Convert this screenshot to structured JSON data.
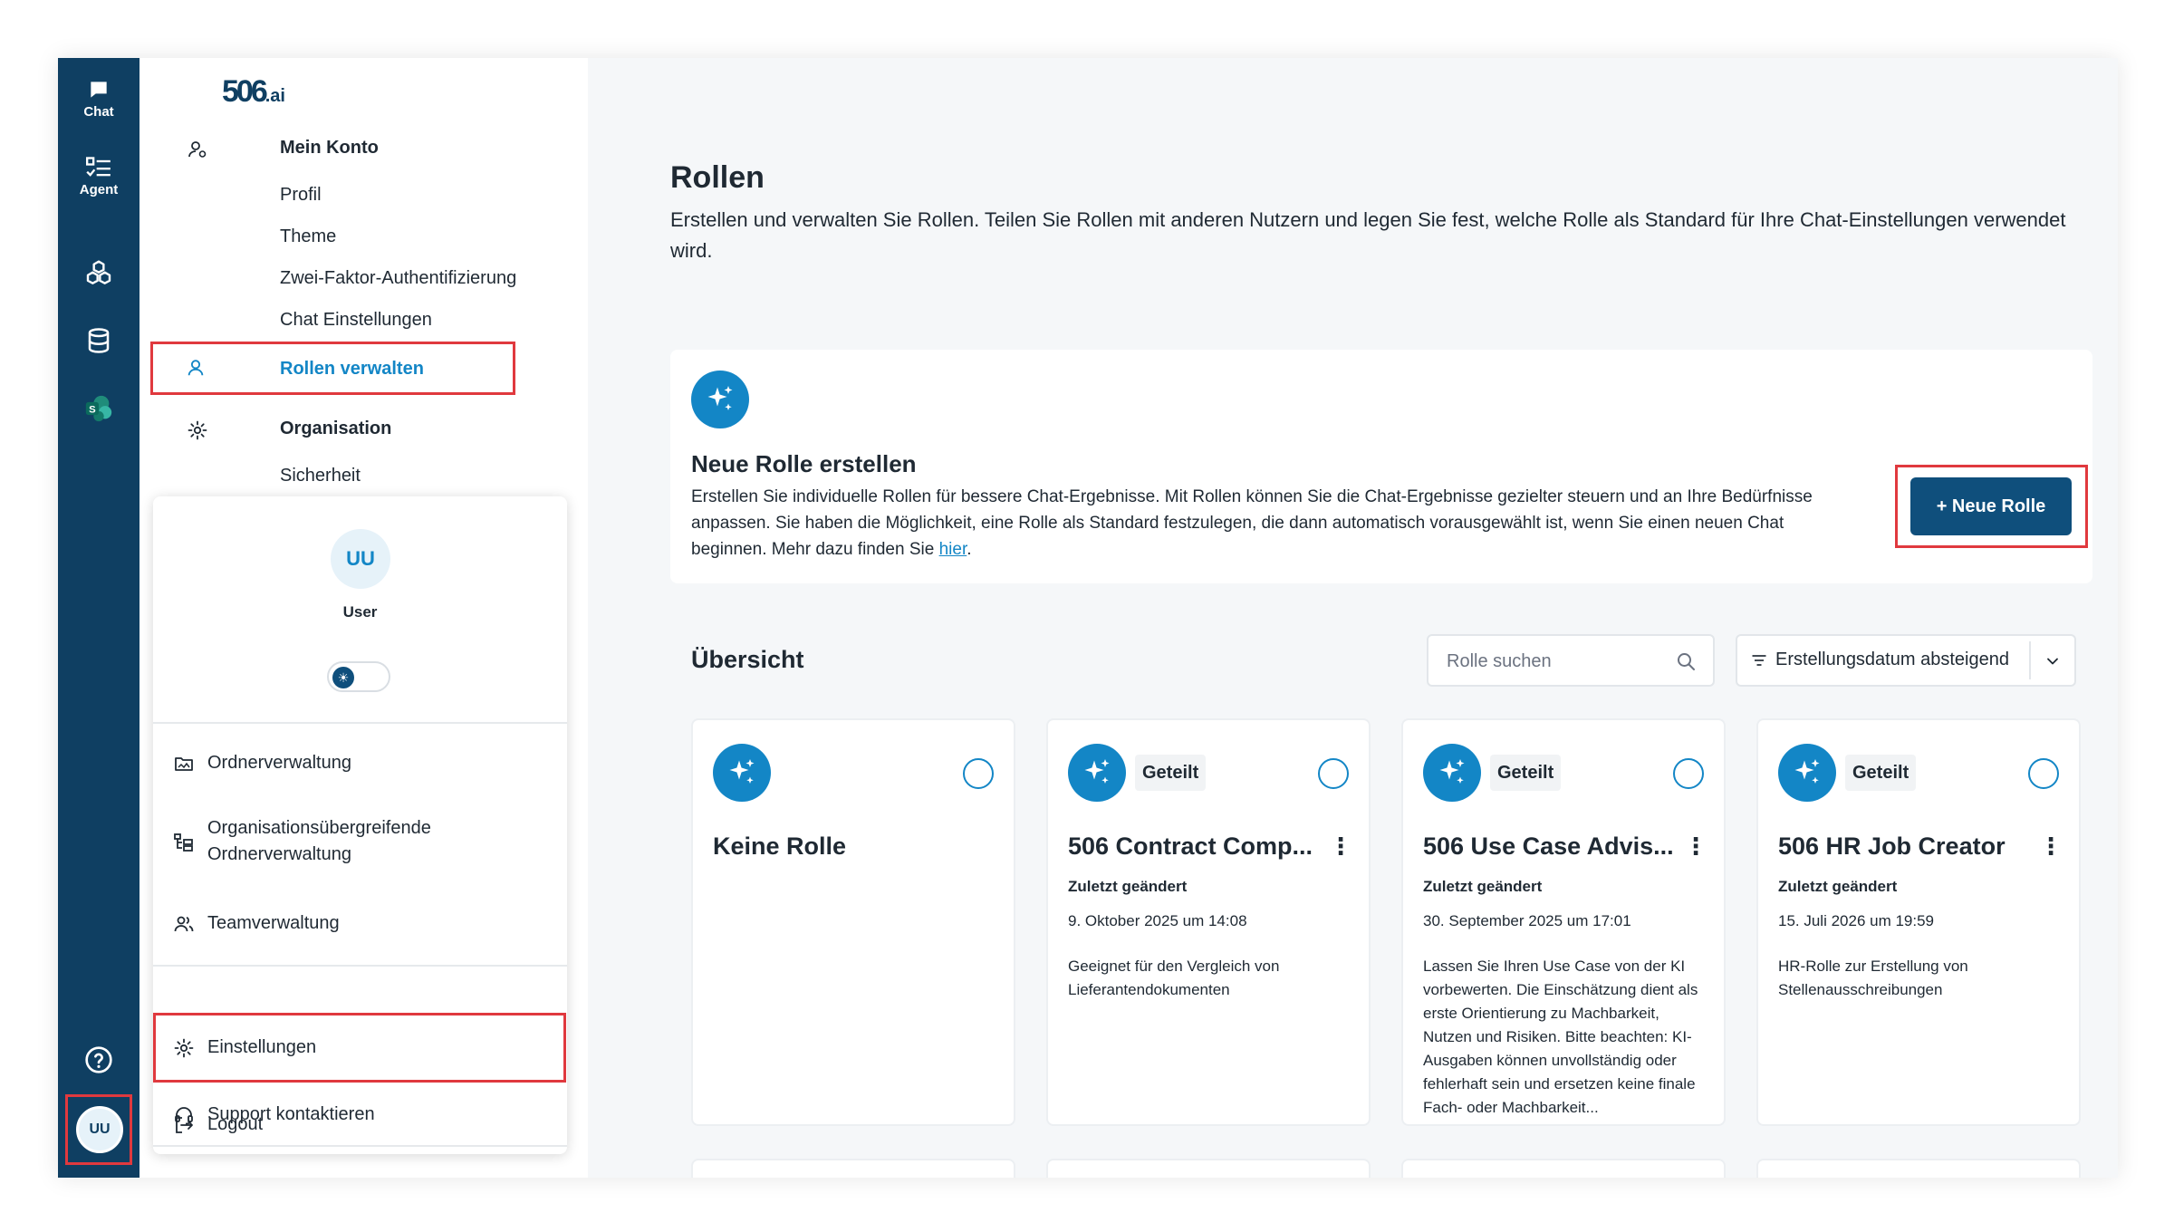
{
  "rail": {
    "chat_label": "Chat",
    "agent_label": "Agent",
    "avatar_initials": "UU"
  },
  "logo": {
    "main": "506",
    "suffix": ".ai"
  },
  "nav": {
    "mein_konto": "Mein Konto",
    "profil": "Profil",
    "theme": "Theme",
    "zwei_faktor": "Zwei-Faktor-Authentifizierung",
    "chat_einstellungen": "Chat Einstellungen",
    "rollen_verwalten": "Rollen verwalten",
    "organisation": "Organisation",
    "sicherheit": "Sicherheit"
  },
  "popover": {
    "avatar_initials": "UU",
    "user_name": "User",
    "items": {
      "ordnerverwaltung": "Ordnerverwaltung",
      "org_ordner_line1": "Organisationsübergreifende",
      "org_ordner_line2": "Ordnerverwaltung",
      "teamverwaltung": "Teamverwaltung",
      "einstellungen": "Einstellungen",
      "support": "Support kontaktieren",
      "logout": "Logout"
    }
  },
  "main": {
    "title": "Rollen",
    "description": "Erstellen und verwalten Sie Rollen. Teilen Sie Rollen mit anderen Nutzern und legen Sie fest, welche Rolle als Standard für Ihre Chat-Einstellungen verwendet wird.",
    "create": {
      "title": "Neue Rolle erstellen",
      "description": "Erstellen Sie individuelle Rollen für bessere Chat-Ergebnisse. Mit Rollen können Sie die Chat-Ergebnisse gezielter steuern und an Ihre Bedürfnisse anpassen. Sie haben die Möglichkeit, eine Rolle als Standard festzulegen, die dann automatisch vorausgewählt ist, wenn Sie einen neuen Chat beginnen. Mehr dazu finden Sie ",
      "link_text": "hier",
      "link_suffix": ".",
      "button_label": "+ Neue Rolle"
    },
    "overview": {
      "title": "Übersicht",
      "search_placeholder": "Rolle suchen",
      "sort_label": "Erstellungsdatum absteigend"
    },
    "roles": [
      {
        "name": "Keine Rolle",
        "badge": "",
        "changed_label": "",
        "changed_date": "",
        "description": ""
      },
      {
        "name": "506 Contract Comp...",
        "badge": "Geteilt",
        "changed_label": "Zuletzt geändert",
        "changed_date": "9. Oktober 2025 um 14:08",
        "description": "Geeignet für den Vergleich von Lieferantendokumenten"
      },
      {
        "name": "506 Use Case Advis...",
        "badge": "Geteilt",
        "changed_label": "Zuletzt geändert",
        "changed_date": "30. September 2025 um 17:01",
        "description": "Lassen Sie Ihren Use Case von der KI vorbewerten. Die Einschätzung dient als erste Orientierung zu Machbarkeit, Nutzen und Risiken. Bitte beachten: KI-Ausgaben können unvollständig oder fehlerhaft sein und ersetzen keine finale Fach- oder Machbarkeit..."
      },
      {
        "name": "506 HR Job Creator",
        "badge": "Geteilt",
        "changed_label": "Zuletzt geändert",
        "changed_date": "15. Juli 2026 um 19:59",
        "description": "HR-Rolle zur Erstellung von Stellenausschreibungen"
      }
    ]
  },
  "colors": {
    "rail": "#0f3f62",
    "accent": "#1386c6",
    "primary_button": "#0f4f7c",
    "highlight": "#e0393e"
  }
}
